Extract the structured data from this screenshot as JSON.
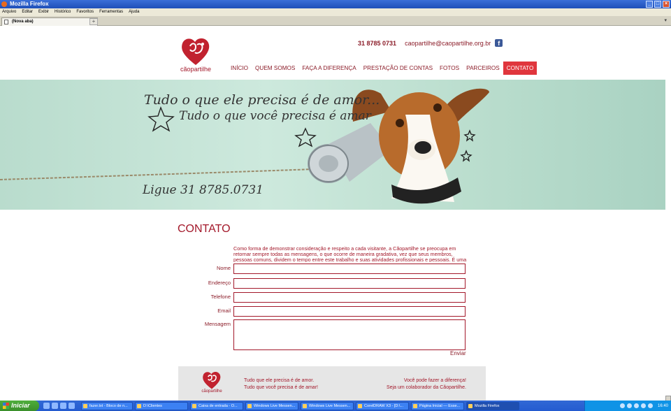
{
  "window": {
    "title": "Mozilla Firefox"
  },
  "menu": [
    "Arquivo",
    "Editar",
    "Exibir",
    "Histórico",
    "Favoritos",
    "Ferramentas",
    "Ajuda"
  ],
  "tab": {
    "title": "(Nova aba)"
  },
  "site": {
    "brand": "cãopartilhe",
    "phone": "31 8785 0731",
    "email": "caopartilhe@caopartilhe.org.br",
    "nav": [
      "INÍCIO",
      "QUEM SOMOS",
      "FAÇA A DIFERENÇA",
      "PRESTAÇÃO DE CONTAS",
      "FOTOS",
      "PARCEIROS",
      "CONTATO"
    ],
    "nav_active": "CONTATO"
  },
  "banner": {
    "line1": "Tudo o que ele precisa é de amor...",
    "line2": "Tudo o que você precisa é amar",
    "line3": "Ligue 31 8785.0731"
  },
  "contact": {
    "heading": "CONTATO",
    "intro": "Como forma de demonstrar consideração e respeito a cada visitante, a Cãopartilhe se preocupa em retornar sempre todas as mensagens, o que ocorre de maneira gradativa, vez que seus membros, pessoas comuns, dividem o tempo entre este trabalho e suas atividades profissionais e pessoais. É uma alegria compartilhar com",
    "labels": {
      "name": "Nome",
      "address": "Endereço",
      "phone": "Telefone",
      "email": "Email",
      "message": "Mensagem"
    },
    "send": "Enviar"
  },
  "footer": {
    "left1": "Tudo que ele precisa é de amor.",
    "left2": "Tudo que você precisa é de amar!",
    "right1": "Você pode fazer a diferença!",
    "right2": "Seja um colaborador da Cãopartilhe."
  },
  "taskbar": {
    "start": "Iniciar",
    "items": [
      "fazer.txt - Bloco de n...",
      "D:\\Clientes",
      "Caixa de entrada - O...",
      "Windows Live Messen...",
      "Windows Live Messen...",
      "CorelDRAW X3 - [D:\\...",
      "Página Inicial — Esse...",
      "Mozilla Firefox"
    ],
    "clock": "16:40"
  },
  "colors": {
    "accent": "#a3182a",
    "nav_active_bg": "#e0363d",
    "banner_bg": "#c4e3d6"
  }
}
